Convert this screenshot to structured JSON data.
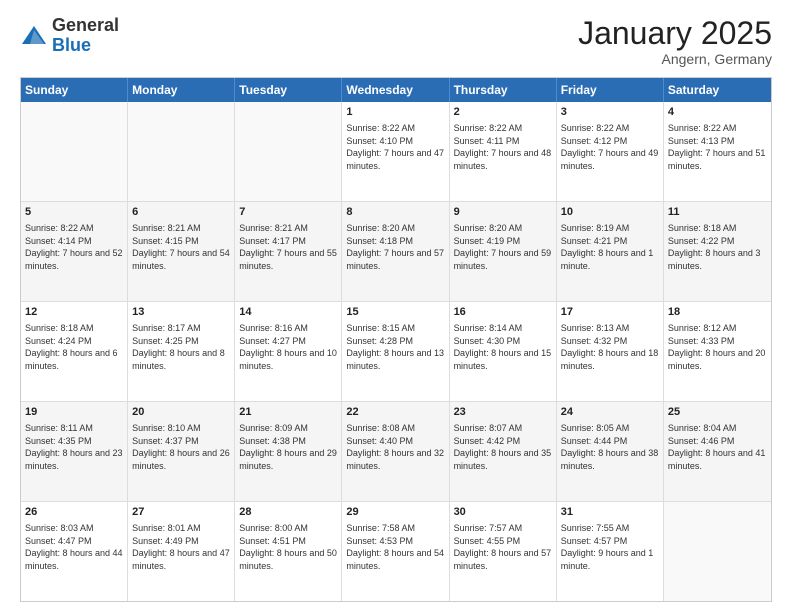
{
  "logo": {
    "general": "General",
    "blue": "Blue"
  },
  "header": {
    "title": "January 2025",
    "location": "Angern, Germany"
  },
  "weekdays": [
    "Sunday",
    "Monday",
    "Tuesday",
    "Wednesday",
    "Thursday",
    "Friday",
    "Saturday"
  ],
  "rows": [
    [
      {
        "day": "",
        "info": ""
      },
      {
        "day": "",
        "info": ""
      },
      {
        "day": "",
        "info": ""
      },
      {
        "day": "1",
        "info": "Sunrise: 8:22 AM\nSunset: 4:10 PM\nDaylight: 7 hours and 47 minutes."
      },
      {
        "day": "2",
        "info": "Sunrise: 8:22 AM\nSunset: 4:11 PM\nDaylight: 7 hours and 48 minutes."
      },
      {
        "day": "3",
        "info": "Sunrise: 8:22 AM\nSunset: 4:12 PM\nDaylight: 7 hours and 49 minutes."
      },
      {
        "day": "4",
        "info": "Sunrise: 8:22 AM\nSunset: 4:13 PM\nDaylight: 7 hours and 51 minutes."
      }
    ],
    [
      {
        "day": "5",
        "info": "Sunrise: 8:22 AM\nSunset: 4:14 PM\nDaylight: 7 hours and 52 minutes."
      },
      {
        "day": "6",
        "info": "Sunrise: 8:21 AM\nSunset: 4:15 PM\nDaylight: 7 hours and 54 minutes."
      },
      {
        "day": "7",
        "info": "Sunrise: 8:21 AM\nSunset: 4:17 PM\nDaylight: 7 hours and 55 minutes."
      },
      {
        "day": "8",
        "info": "Sunrise: 8:20 AM\nSunset: 4:18 PM\nDaylight: 7 hours and 57 minutes."
      },
      {
        "day": "9",
        "info": "Sunrise: 8:20 AM\nSunset: 4:19 PM\nDaylight: 7 hours and 59 minutes."
      },
      {
        "day": "10",
        "info": "Sunrise: 8:19 AM\nSunset: 4:21 PM\nDaylight: 8 hours and 1 minute."
      },
      {
        "day": "11",
        "info": "Sunrise: 8:18 AM\nSunset: 4:22 PM\nDaylight: 8 hours and 3 minutes."
      }
    ],
    [
      {
        "day": "12",
        "info": "Sunrise: 8:18 AM\nSunset: 4:24 PM\nDaylight: 8 hours and 6 minutes."
      },
      {
        "day": "13",
        "info": "Sunrise: 8:17 AM\nSunset: 4:25 PM\nDaylight: 8 hours and 8 minutes."
      },
      {
        "day": "14",
        "info": "Sunrise: 8:16 AM\nSunset: 4:27 PM\nDaylight: 8 hours and 10 minutes."
      },
      {
        "day": "15",
        "info": "Sunrise: 8:15 AM\nSunset: 4:28 PM\nDaylight: 8 hours and 13 minutes."
      },
      {
        "day": "16",
        "info": "Sunrise: 8:14 AM\nSunset: 4:30 PM\nDaylight: 8 hours and 15 minutes."
      },
      {
        "day": "17",
        "info": "Sunrise: 8:13 AM\nSunset: 4:32 PM\nDaylight: 8 hours and 18 minutes."
      },
      {
        "day": "18",
        "info": "Sunrise: 8:12 AM\nSunset: 4:33 PM\nDaylight: 8 hours and 20 minutes."
      }
    ],
    [
      {
        "day": "19",
        "info": "Sunrise: 8:11 AM\nSunset: 4:35 PM\nDaylight: 8 hours and 23 minutes."
      },
      {
        "day": "20",
        "info": "Sunrise: 8:10 AM\nSunset: 4:37 PM\nDaylight: 8 hours and 26 minutes."
      },
      {
        "day": "21",
        "info": "Sunrise: 8:09 AM\nSunset: 4:38 PM\nDaylight: 8 hours and 29 minutes."
      },
      {
        "day": "22",
        "info": "Sunrise: 8:08 AM\nSunset: 4:40 PM\nDaylight: 8 hours and 32 minutes."
      },
      {
        "day": "23",
        "info": "Sunrise: 8:07 AM\nSunset: 4:42 PM\nDaylight: 8 hours and 35 minutes."
      },
      {
        "day": "24",
        "info": "Sunrise: 8:05 AM\nSunset: 4:44 PM\nDaylight: 8 hours and 38 minutes."
      },
      {
        "day": "25",
        "info": "Sunrise: 8:04 AM\nSunset: 4:46 PM\nDaylight: 8 hours and 41 minutes."
      }
    ],
    [
      {
        "day": "26",
        "info": "Sunrise: 8:03 AM\nSunset: 4:47 PM\nDaylight: 8 hours and 44 minutes."
      },
      {
        "day": "27",
        "info": "Sunrise: 8:01 AM\nSunset: 4:49 PM\nDaylight: 8 hours and 47 minutes."
      },
      {
        "day": "28",
        "info": "Sunrise: 8:00 AM\nSunset: 4:51 PM\nDaylight: 8 hours and 50 minutes."
      },
      {
        "day": "29",
        "info": "Sunrise: 7:58 AM\nSunset: 4:53 PM\nDaylight: 8 hours and 54 minutes."
      },
      {
        "day": "30",
        "info": "Sunrise: 7:57 AM\nSunset: 4:55 PM\nDaylight: 8 hours and 57 minutes."
      },
      {
        "day": "31",
        "info": "Sunrise: 7:55 AM\nSunset: 4:57 PM\nDaylight: 9 hours and 1 minute."
      },
      {
        "day": "",
        "info": ""
      }
    ]
  ]
}
